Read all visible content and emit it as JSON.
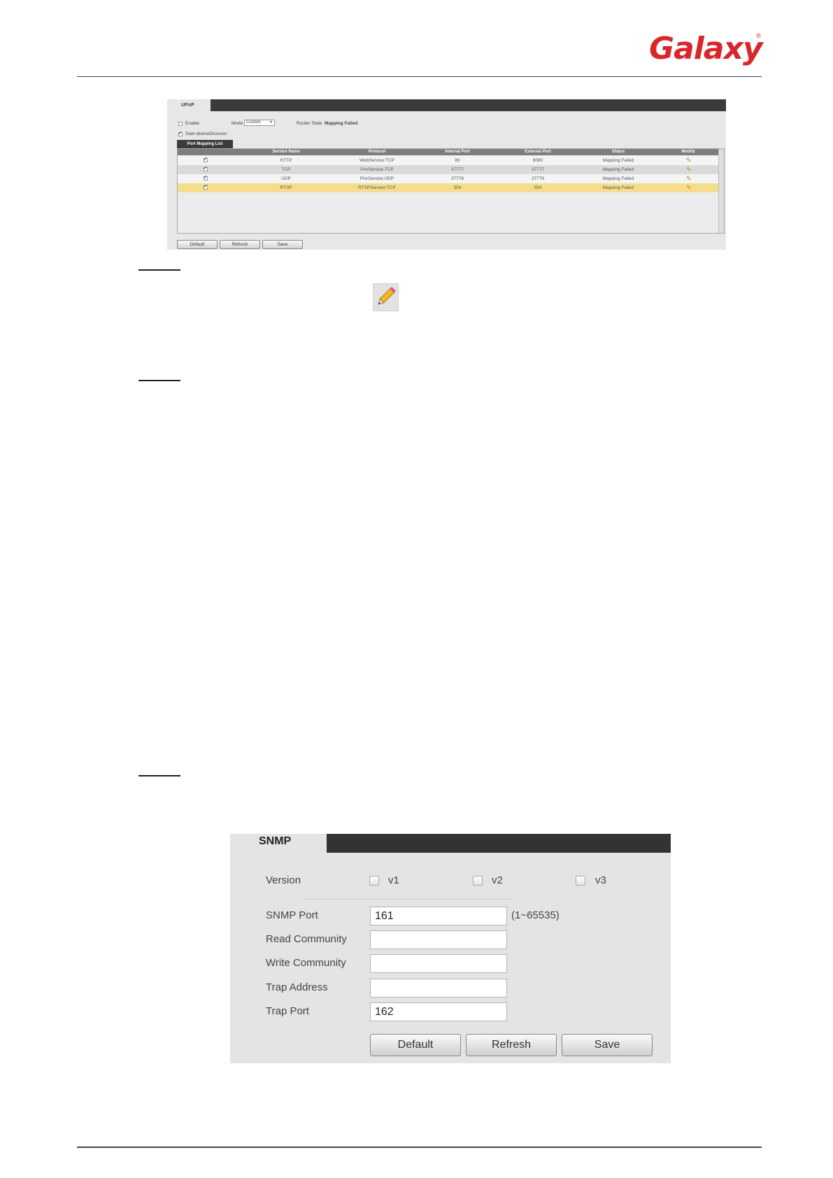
{
  "brand": {
    "name": "Galaxy",
    "reg_mark": "®"
  },
  "upnp": {
    "tab": "UPnP",
    "enable_label": "Enable",
    "enable_checked": false,
    "mode_label": "Mode",
    "mode_value": "Custom",
    "router_state_label": "Router State",
    "router_state_value": "Mapping Failed",
    "start_discover_label": "Start deviceDiscover",
    "start_discover_checked": true,
    "list_tab": "Port Mapping List",
    "columns": [
      "Service Name",
      "Protocol",
      "Internal Port",
      "External Port",
      "Status",
      "Modify"
    ],
    "rows": [
      {
        "checked": true,
        "service": "HTTP",
        "protocol": "WebService:TCP",
        "internal": "80",
        "external": "8080",
        "status": "Mapping Failed"
      },
      {
        "checked": true,
        "service": "TCP",
        "protocol": "PrivService:TCP",
        "internal": "37777",
        "external": "37777",
        "status": "Mapping Failed"
      },
      {
        "checked": true,
        "service": "UDP",
        "protocol": "PrivService:UDP",
        "internal": "37778",
        "external": "37778",
        "status": "Mapping Failed"
      },
      {
        "checked": true,
        "service": "RTSP",
        "protocol": "RTSPService:TCP",
        "internal": "554",
        "external": "554",
        "status": "Mapping Failed"
      }
    ],
    "buttons": {
      "default": "Default",
      "refresh": "Refresh",
      "save": "Save"
    }
  },
  "snmp": {
    "tab": "SNMP",
    "version_label": "Version",
    "versions": [
      {
        "label": "v1",
        "checked": false
      },
      {
        "label": "v2",
        "checked": false
      },
      {
        "label": "v3",
        "checked": false
      }
    ],
    "port_label": "SNMP Port",
    "port_value": "161",
    "port_range": "(1~65535)",
    "read_community_label": "Read Community",
    "read_community_value": "",
    "write_community_label": "Write Community",
    "write_community_value": "",
    "trap_address_label": "Trap Address",
    "trap_address_value": "",
    "trap_port_label": "Trap Port",
    "trap_port_value": "162",
    "buttons": {
      "default": "Default",
      "refresh": "Refresh",
      "save": "Save"
    }
  },
  "colors": {
    "brand_red": "#d9262b",
    "highlight_row": "#f6dd8e",
    "tab_bar": "#333333"
  },
  "icons": {
    "modify": "pencil-icon"
  }
}
